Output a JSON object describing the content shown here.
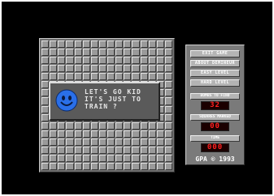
{
  "dialog": {
    "message": "LET'S GO KID\nIT'S JUST TO\nTRAIN ?"
  },
  "menu": {
    "exit_game": "EXIT GAME",
    "about": "ABOUT DEMINEUR",
    "easy_level": "EASY LEVEL",
    "hard_level": "HARD LEVEL"
  },
  "stats": {
    "bombs_label": "BOMBS TO FIND",
    "bombs_value": "32",
    "marked_label": "SQUARES MARKED",
    "marked_value": "00",
    "time_label": "TIME",
    "time_value": "000"
  },
  "copyright": "GPA © 1993",
  "colors": {
    "smiley_face": "#2a6fe8",
    "counter_text": "#ff2020"
  },
  "icons": {
    "dialog_icon": "smiley-icon"
  }
}
